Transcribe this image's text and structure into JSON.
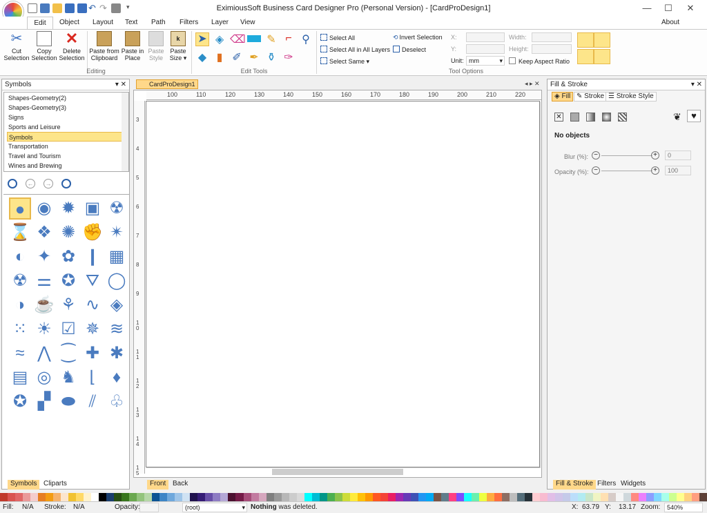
{
  "window": {
    "title": "EximiousSoft Business Card Designer Pro (Personal Version) - [CardProDesign1]",
    "about": "About",
    "minimize": "—",
    "maximize": "☐",
    "close": "✕"
  },
  "menu": [
    "Edit",
    "Object",
    "Layout",
    "Text",
    "Path",
    "Filters",
    "Layer",
    "View"
  ],
  "ribbon": {
    "cut": "Cut",
    "cut2": "Selection",
    "copy": "Copy",
    "copy2": "Selection",
    "delete": "Delete",
    "delete2": "Selection",
    "paste_clip": "Paste from",
    "paste_clip2": "Clipboard",
    "paste_place": "Paste in",
    "paste_place2": "Place",
    "paste_style": "Paste",
    "paste_style2": "Style",
    "paste_size": "Paste",
    "paste_size2": "Size ▾",
    "group_editing": "Editing",
    "group_edit_tools": "Edit Tools",
    "group_tool_options": "Tool Options",
    "select_all": "Select All",
    "select_all_layers": "Select All in All Layers",
    "select_same": "Select Same ▾",
    "invert_selection": "Invert Selection",
    "deselect": "Deselect",
    "x_label": "X:",
    "y_label": "Y:",
    "unit_label": "Unit:",
    "unit_value": "mm",
    "width_label": "Width:",
    "height_label": "Height:",
    "keep_aspect": "Keep Aspect Ratio"
  },
  "symbols_panel": {
    "title": "Symbols",
    "categories": [
      "Shapes-Geometry(2)",
      "Shapes-Geometry(3)",
      "Signs",
      "Sports and Leisure",
      "Symbols",
      "Transportation",
      "Travel and Tourism",
      "Wines and Brewing"
    ],
    "selected_index": 4,
    "bottom_tabs": [
      "Symbols",
      "Cliparts"
    ]
  },
  "document": {
    "tab_label": "CardProDesign1",
    "ruler_h": [
      "100",
      "110",
      "120",
      "130",
      "140",
      "150",
      "160",
      "170",
      "180",
      "190",
      "200",
      "210",
      "220"
    ],
    "ruler_v": [
      "3",
      "4",
      "5",
      "6",
      "7",
      "8",
      "9",
      "10",
      "11",
      "12",
      "13",
      "14",
      "15"
    ],
    "page_tabs": [
      "Front",
      "Back"
    ]
  },
  "fill_stroke": {
    "title": "Fill & Stroke",
    "tabs": [
      "Fill",
      "Stroke",
      "Stroke Style"
    ],
    "status": "No objects",
    "blur_label": "Blur (%):",
    "blur_value": "0",
    "opacity_label": "Opacity (%):",
    "opacity_value": "100",
    "bottom_tabs": [
      "Fill & Stroke",
      "Filters",
      "Widgets"
    ]
  },
  "palette": [
    "#c0392b",
    "#d9534f",
    "#e06666",
    "#ea9999",
    "#f4cccc",
    "#e67e22",
    "#f39c12",
    "#f6b26b",
    "#fce5cd",
    "#f1c232",
    "#ffd966",
    "#fff2cc",
    "#ffffff",
    "#000000",
    "#1a3d6d",
    "#274e13",
    "#38761d",
    "#6aa84f",
    "#93c47d",
    "#b6d7a8",
    "#0b5394",
    "#3d85c6",
    "#6fa8dc",
    "#9fc5e8",
    "#cfe2f3",
    "#20124d",
    "#351c75",
    "#674ea7",
    "#8e7cc3",
    "#b4a7d6",
    "#4c1130",
    "#741b47",
    "#a64d79",
    "#c27ba0",
    "#d5a6bd",
    "#7f7f7f",
    "#999999",
    "#b7b7b7",
    "#cccccc",
    "#d9d9d9",
    "#00ffff",
    "#00bcd4",
    "#009688",
    "#4caf50",
    "#8bc34a",
    "#cddc39",
    "#ffeb3b",
    "#ffc107",
    "#ff9800",
    "#ff5722",
    "#f44336",
    "#e91e63",
    "#9c27b0",
    "#673ab7",
    "#3f51b5",
    "#2196f3",
    "#03a9f4",
    "#795548",
    "#607d8b",
    "#ff4081",
    "#7c4dff",
    "#18ffff",
    "#69f0ae",
    "#eeff41",
    "#ffab40",
    "#ff6e40",
    "#8d6e63",
    "#bdbdbd",
    "#546e7a",
    "#263238",
    "#ffcdd2",
    "#f8bbd0",
    "#e1bee7",
    "#d1c4e9",
    "#c5cae9",
    "#bbdefb",
    "#b2ebf2",
    "#c8e6c9",
    "#f0f4c3",
    "#ffe0b2",
    "#d7ccc8",
    "#f5f5f5",
    "#cfd8dc",
    "#ff8a80",
    "#ea80fc",
    "#8c9eff",
    "#80d8ff",
    "#a7ffeb",
    "#ccff90",
    "#ffff8d",
    "#ffd180",
    "#ff9e80",
    "#5d4037"
  ],
  "status": {
    "fill_label": "Fill:",
    "fill_value": "N/A",
    "stroke_label": "Stroke:",
    "stroke_value": "N/A",
    "opacity_label": "Opacity:",
    "layer_value": "(root)",
    "message_bold": "Nothing",
    "message_rest": " was deleted.",
    "x_label": "X:",
    "x_value": "63.79",
    "y_label": "Y:",
    "y_value": "13.17",
    "zoom_label": "Zoom:",
    "zoom_value": "540%"
  },
  "colors": {
    "accent": "#ffd88a",
    "icon_blue": "#4a7bbf",
    "selected": "#fde58a"
  }
}
